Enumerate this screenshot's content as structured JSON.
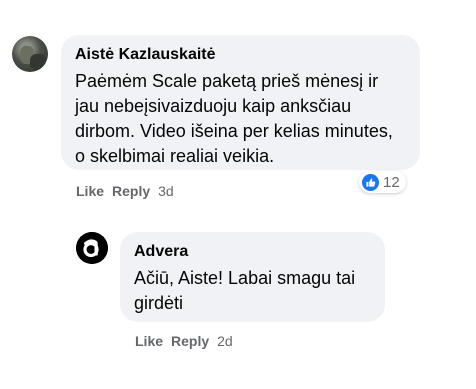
{
  "comment": {
    "author": "Aistė Kazlauskaitė",
    "text": "Paėmėm Scale paketą prieš mėnesį ir jau nebeįsivaizduoju kaip anksčiau dirbom. Video išeina per kelias minutes, o skelbimai realiai veikia.",
    "like_label": "Like",
    "reply_label": "Reply",
    "time": "3d",
    "reaction_icon": "like-icon",
    "reaction_count": "12"
  },
  "reply": {
    "author": "Advera",
    "text": "Ačiū, Aiste! Labai smagu tai girdėti",
    "like_label": "Like",
    "reply_label": "Reply",
    "time": "2d",
    "avatar_icon": "advera-logo-icon"
  },
  "colors": {
    "bubble_bg": "#f0f2f5",
    "meta_text": "#65676b",
    "like_blue": "#1877f2"
  }
}
